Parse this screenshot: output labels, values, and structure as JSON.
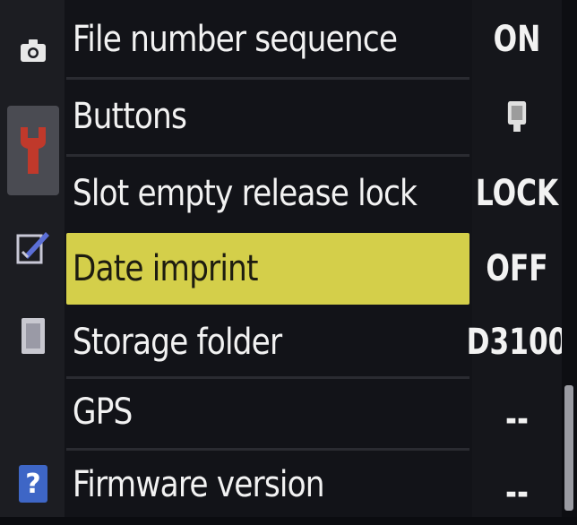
{
  "menu": {
    "items": [
      {
        "label": "File number sequence",
        "value": "ON"
      },
      {
        "label": "Buttons",
        "value_icon": "button-assign-icon"
      },
      {
        "label": "Slot empty release lock",
        "value": "LOCK"
      },
      {
        "label": "Date imprint",
        "value": "OFF",
        "selected": true
      },
      {
        "label": "Storage folder",
        "value": "D3100"
      },
      {
        "label": "GPS",
        "value": "--"
      },
      {
        "label": "Firmware version",
        "value": "--"
      }
    ]
  },
  "tabs": [
    {
      "icon": "camera-icon"
    },
    {
      "icon": "wrench-icon",
      "active": true
    },
    {
      "icon": "retouch-icon"
    },
    {
      "icon": "recent-settings-icon"
    },
    {
      "icon": "help-icon",
      "label": "?"
    }
  ],
  "colors": {
    "selection": "#d4cf4a",
    "background": "#121318",
    "text": "#f2f2f2"
  }
}
